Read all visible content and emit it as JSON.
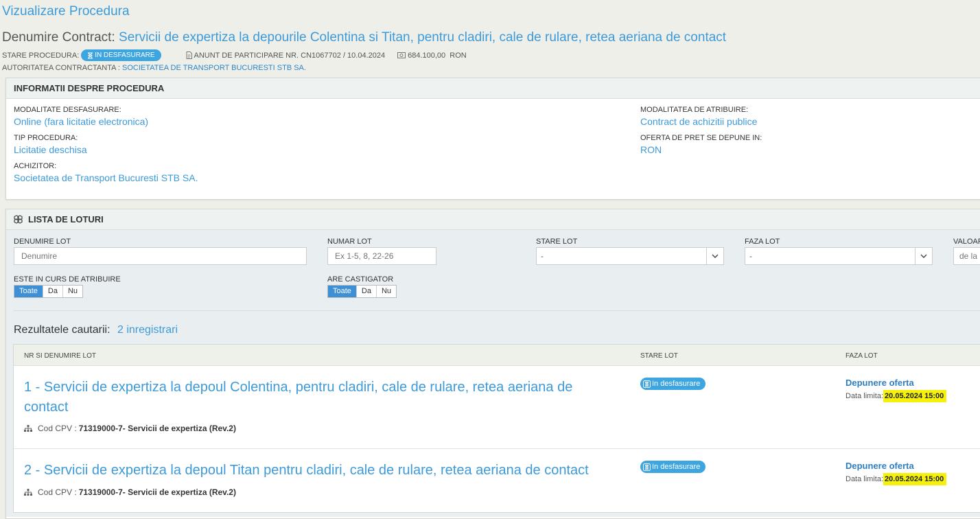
{
  "header": {
    "page_title": "Vizualizare Procedura",
    "contract_label": "Denumire Contract:",
    "contract_name": "Servicii de expertiza la depourile Colentina si Titan, pentru cladiri, cale de rulare, retea aeriana de contact",
    "stare_label": "STARE PROCEDURA:",
    "stare_value": "IN DESFASURARE",
    "anunt": "ANUNT DE PARTICIPARE NR. CN1067702 / 10.04.2024",
    "valoare": "684.100,00",
    "moneda": "RON",
    "autoritate_label": "AUTORITATEA CONTRACTANTA :",
    "autoritate_value": "SOCIETATEA DE TRANSPORT BUCURESTI STB SA."
  },
  "info": {
    "title": "INFORMATII DESPRE PROCEDURA",
    "modalitate_label": "MODALITATE DESFASURARE:",
    "modalitate_value": "Online (fara licitatie electronica)",
    "tip_label": "TIP PROCEDURA:",
    "tip_value": "Licitatie deschisa",
    "achizitor_label": "ACHIZITOR:",
    "achizitor_value": "Societatea de Transport Bucuresti STB SA.",
    "atribuire_label": "MODALITATEA DE ATRIBUIRE:",
    "atribuire_value": "Contract de achizitii publice",
    "oferta_label": "OFERTA DE PRET SE DEPUNE IN:",
    "oferta_value": "RON"
  },
  "loturi": {
    "title": "LISTA DE LOTURI",
    "denumire_label": "DENUMIRE LOT",
    "denumire_placeholder": "Denumire",
    "numar_label": "NUMAR LOT",
    "numar_placeholder": "Ex 1-5, 8, 22-26",
    "stare_label": "STARE LOT",
    "stare_value": "-",
    "faza_label": "FAZA LOT",
    "faza_value": "-",
    "valoare_label": "VALOAR",
    "valoare_placeholder": "de la",
    "atribuire_label": "ESTE IN CURS DE ATRIBUIRE",
    "castigator_label": "ARE CASTIGATOR",
    "seg_toate": "Toate",
    "seg_da": "Da",
    "seg_nu": "Nu",
    "results_label": "Rezultatele cautarii:",
    "results_count": "2 inregistrari",
    "col_nr": "NR SI DENUMIRE LOT",
    "col_stare": "STARE LOT",
    "col_faza": "FAZA LOT",
    "rows": [
      {
        "title": "1 - Servicii de expertiza la depoul Colentina, pentru cladiri, cale de rulare, retea aeriana de contact",
        "cpv_label": "Cod CPV :",
        "cpv_code": "71319000-7",
        "cpv_desc": " - Servicii de expertiza (Rev.2)",
        "stare": "In desfasurare",
        "faza": "Depunere oferta",
        "limit_label": "Data limita:",
        "limit_value": "20.05.2024 15:00"
      },
      {
        "title": "2 - Servicii de expertiza la depoul Titan pentru cladiri, cale de rulare, retea aeriana de contact",
        "cpv_label": "Cod CPV :",
        "cpv_code": "71319000-7",
        "cpv_desc": " - Servicii de expertiza (Rev.2)",
        "stare": "In desfasurare",
        "faza": "Depunere oferta",
        "limit_label": "Data limita:",
        "limit_value": "20.05.2024 15:00"
      }
    ]
  }
}
